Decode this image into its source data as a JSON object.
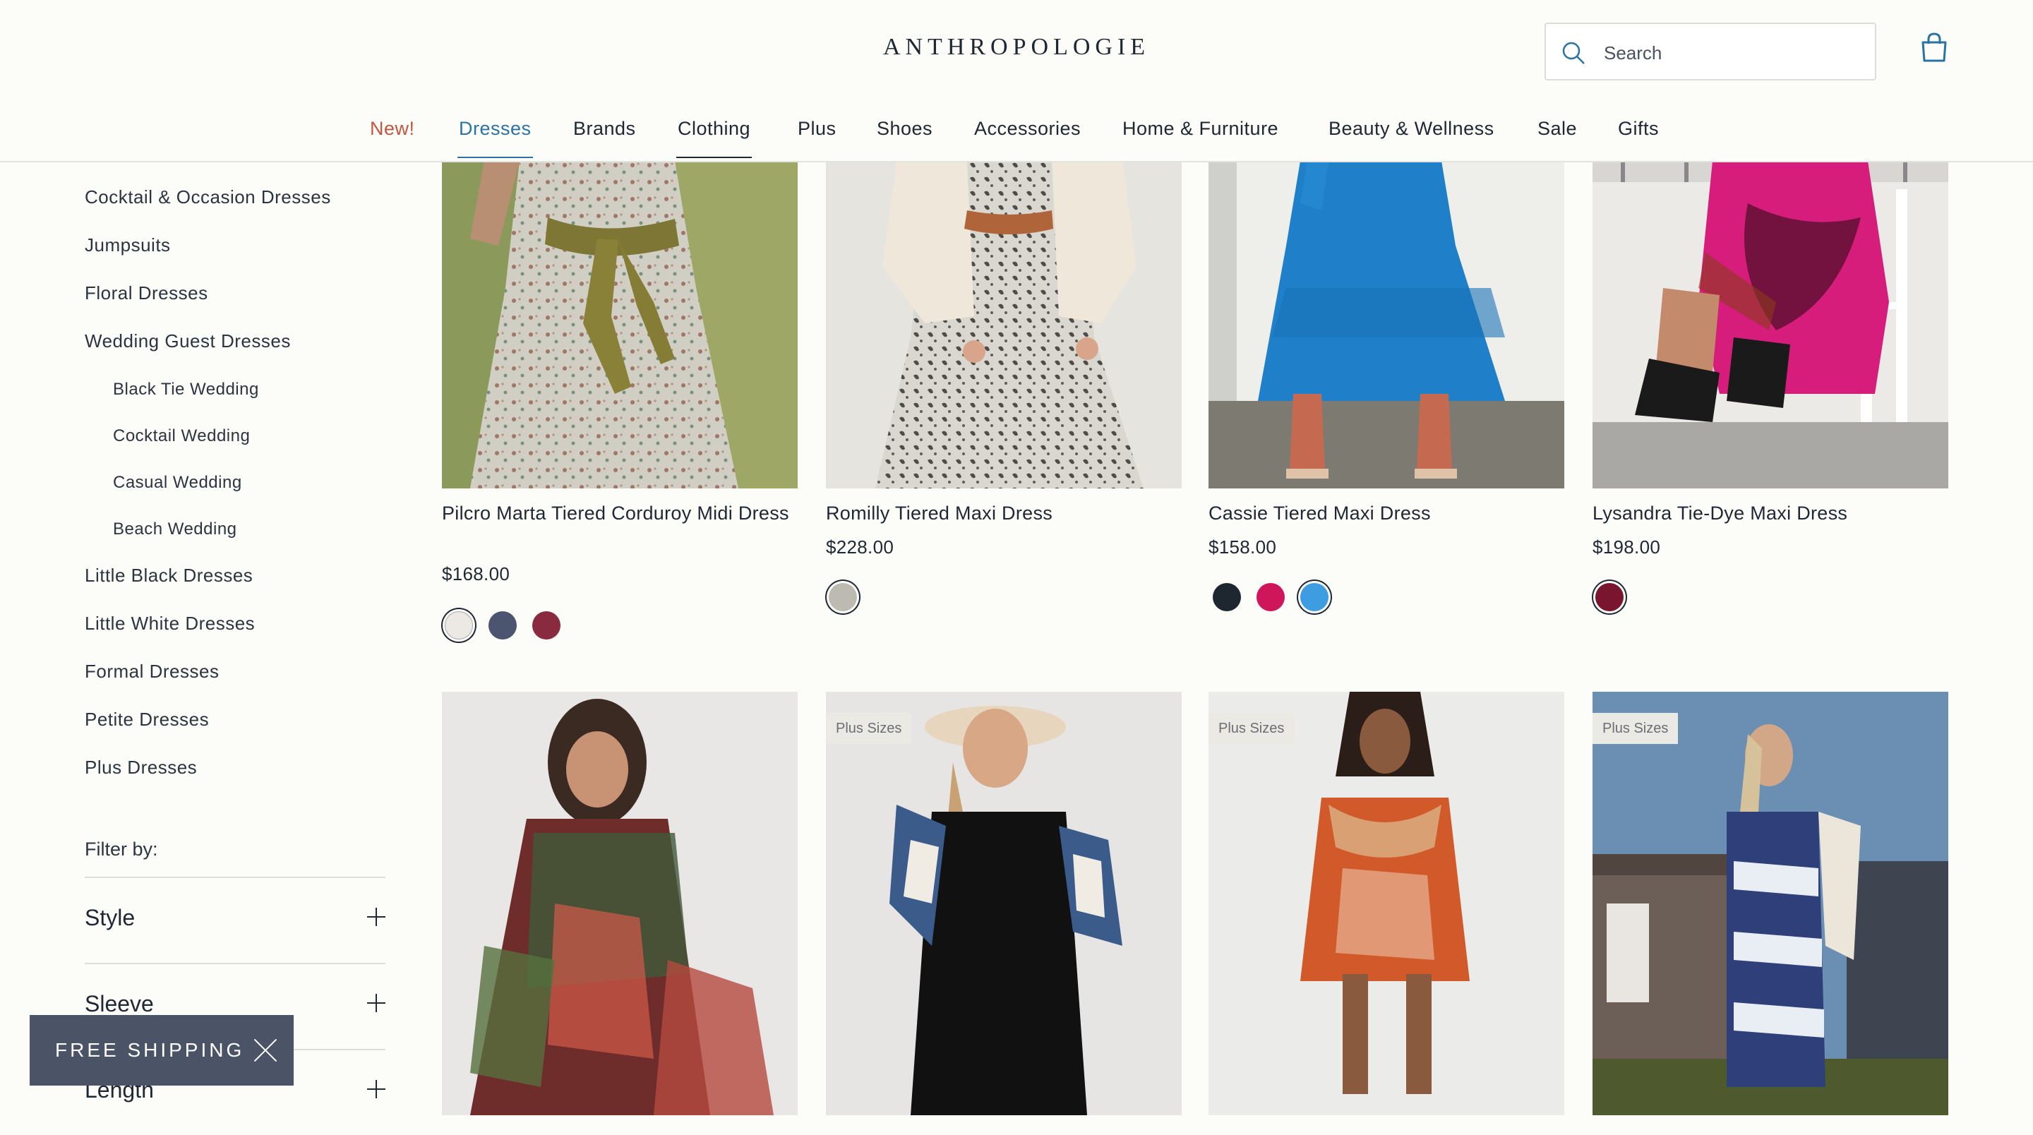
{
  "brand": {
    "logo_text": "ANTHROPOLOGIE"
  },
  "search": {
    "placeholder": "Search"
  },
  "nav": {
    "items": [
      {
        "label": "New!"
      },
      {
        "label": "Dresses"
      },
      {
        "label": "Brands"
      },
      {
        "label": "Clothing"
      },
      {
        "label": "Plus"
      },
      {
        "label": "Shoes"
      },
      {
        "label": "Accessories"
      },
      {
        "label": "Home & Furniture"
      },
      {
        "label": "Beauty & Wellness"
      },
      {
        "label": "Sale"
      },
      {
        "label": "Gifts"
      }
    ],
    "active": "Dresses"
  },
  "sidebar": {
    "categories": [
      {
        "label": "Cocktail & Occasion Dresses"
      },
      {
        "label": "Jumpsuits"
      },
      {
        "label": "Floral Dresses"
      },
      {
        "label": "Wedding Guest Dresses"
      },
      {
        "label": "Black Tie Wedding"
      },
      {
        "label": "Cocktail Wedding"
      },
      {
        "label": "Casual Wedding"
      },
      {
        "label": "Beach Wedding"
      },
      {
        "label": "Little Black Dresses"
      },
      {
        "label": "Little White Dresses"
      },
      {
        "label": "Formal Dresses"
      },
      {
        "label": "Petite Dresses"
      },
      {
        "label": "Plus Dresses"
      }
    ],
    "filter_heading": "Filter by:",
    "filters": [
      {
        "label": "Style"
      },
      {
        "label": "Sleeve"
      },
      {
        "label": "Length"
      }
    ]
  },
  "promo": {
    "free_shipping_label": "FREE SHIPPING"
  },
  "products": [
    {
      "name": "Pilcro Marta Tiered Corduroy Midi Dress",
      "price": "$168.00",
      "swatches": [
        "#ece8e4",
        "#4b5570",
        "#8a2a40"
      ],
      "selected_swatch": 0
    },
    {
      "name": "Romilly Tiered Maxi Dress",
      "price": "$228.00",
      "swatches": [
        "#bdbab2"
      ],
      "selected_swatch": 0
    },
    {
      "name": "Cassie Tiered Maxi Dress",
      "price": "$158.00",
      "swatches": [
        "#1e2630",
        "#d0165a",
        "#3d9de0"
      ],
      "selected_swatch": 2
    },
    {
      "name": "Lysandra Tie-Dye Maxi Dress",
      "price": "$198.00",
      "swatches": [
        "#7a1530"
      ],
      "selected_swatch": 0
    }
  ],
  "products_row2": [
    {
      "badge": ""
    },
    {
      "badge": "Plus Sizes"
    },
    {
      "badge": "Plus Sizes"
    },
    {
      "badge": "Plus Sizes"
    }
  ],
  "colors": {
    "accent_blue": "#2a73a3",
    "new_red": "#c4553f",
    "promo_bg": "#4a5466"
  }
}
